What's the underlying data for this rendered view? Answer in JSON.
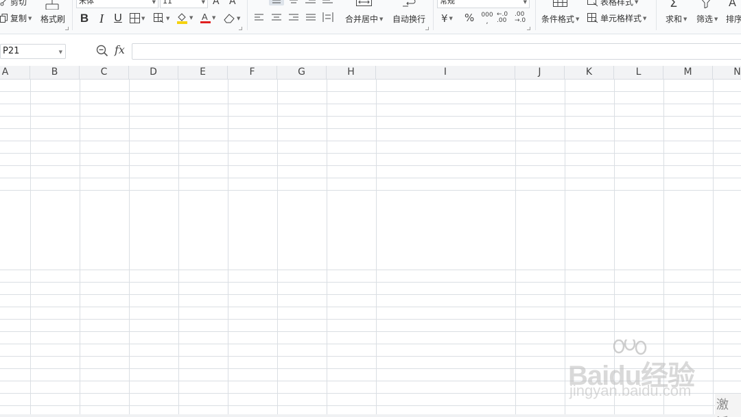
{
  "ribbon": {
    "clipboard": {
      "cut": "剪切",
      "copy": "复制",
      "format_painter": "格式刷"
    },
    "font": {
      "name": "宋体",
      "size": "11"
    },
    "alignment": {
      "merge_center": "合并居中",
      "wrap_text": "自动换行"
    },
    "number": {
      "format": "常规",
      "currency_symbol": "¥",
      "percent": "%",
      "thousands": "000",
      "inc_decimal": "←.0\n.00",
      "dec_decimal": ".00\n→.0"
    },
    "styles": {
      "conditional_format": "条件格式",
      "table_style": "表格样式",
      "cell_style": "单元格样式"
    },
    "editing": {
      "sum": "求和",
      "filter": "筛选",
      "sort": "排序"
    }
  },
  "formula_bar": {
    "cell_ref": "P21",
    "fx_label": "fx",
    "formula": ""
  },
  "columns": [
    "A",
    "B",
    "C",
    "D",
    "E",
    "F",
    "G",
    "H",
    "I",
    "J",
    "K",
    "L",
    "M",
    "N"
  ],
  "watermark": {
    "main": "Baidu经验",
    "sub": "jingyan.baidu.com"
  },
  "activate_text": "激活",
  "colors": {
    "font_color_bar": "#e02020",
    "fill_color_bar": "#f5d20f",
    "grid_line": "#dadee3"
  }
}
